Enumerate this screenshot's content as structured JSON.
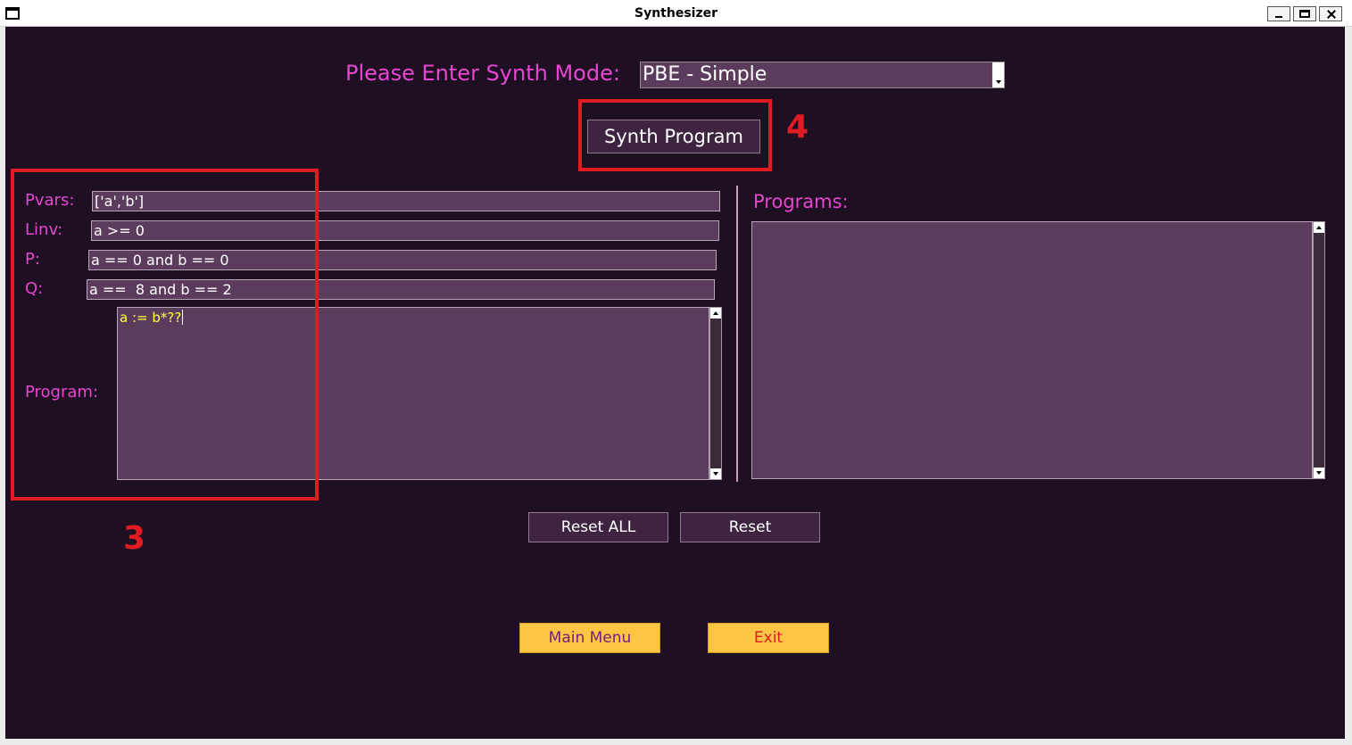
{
  "window": {
    "title": "Synthesizer"
  },
  "mode": {
    "label": "Please Enter Synth Mode:",
    "selected": "PBE - Simple"
  },
  "synth_button": "Synth Program",
  "fields": {
    "pvars": {
      "label": "Pvars:",
      "value": "['a','b']"
    },
    "linv": {
      "label": "Linv:",
      "value": "a >= 0"
    },
    "p": {
      "label": "P:",
      "value": "a == 0 and b == 0"
    },
    "q": {
      "label": "Q:",
      "value": "a ==  8 and b == 2"
    },
    "program": {
      "label": "Program:",
      "value": "a := b*??"
    }
  },
  "programs": {
    "label": "Programs:"
  },
  "buttons": {
    "reset_all": "Reset ALL",
    "reset": "Reset",
    "main_menu": "Main Menu",
    "exit": "Exit"
  },
  "annotations": {
    "box_3": "3",
    "box_4": "4"
  },
  "colors": {
    "background": "#1f0f22",
    "label": "#e845d2",
    "input_bg": "#5c3c5c",
    "program_text": "#ffff3a",
    "annotation": "#e11b22",
    "yellow_button": "#fbc644"
  }
}
